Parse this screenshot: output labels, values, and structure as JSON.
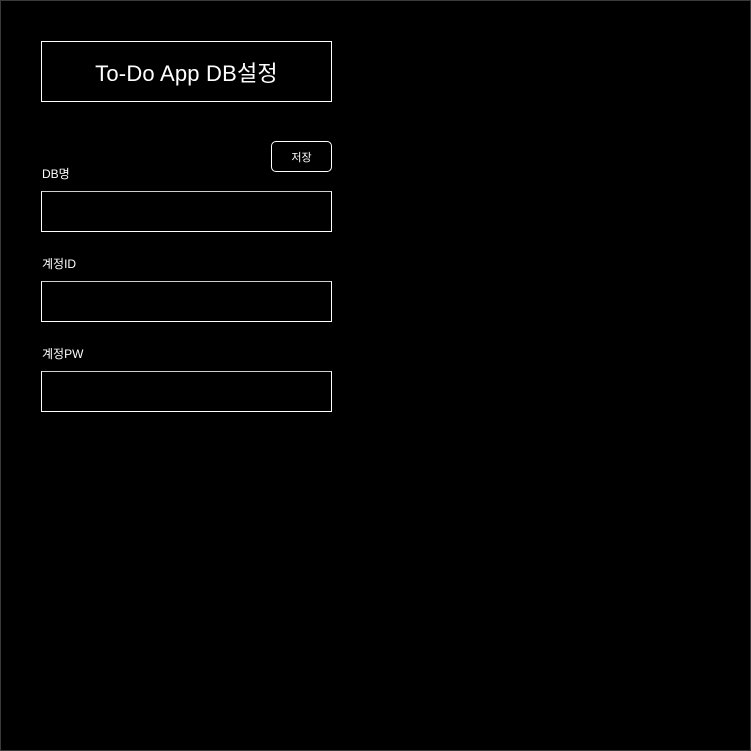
{
  "header": {
    "title": "To-Do App DB설정"
  },
  "toolbar": {
    "save_label": "저장"
  },
  "form": {
    "db_name": {
      "label": "DB명",
      "value": "",
      "placeholder": ""
    },
    "account_id": {
      "label": "계정ID",
      "value": "",
      "placeholder": ""
    },
    "account_pw": {
      "label": "계정PW",
      "value": "",
      "placeholder": ""
    }
  },
  "colors": {
    "background": "#000000",
    "foreground": "#ffffff"
  }
}
